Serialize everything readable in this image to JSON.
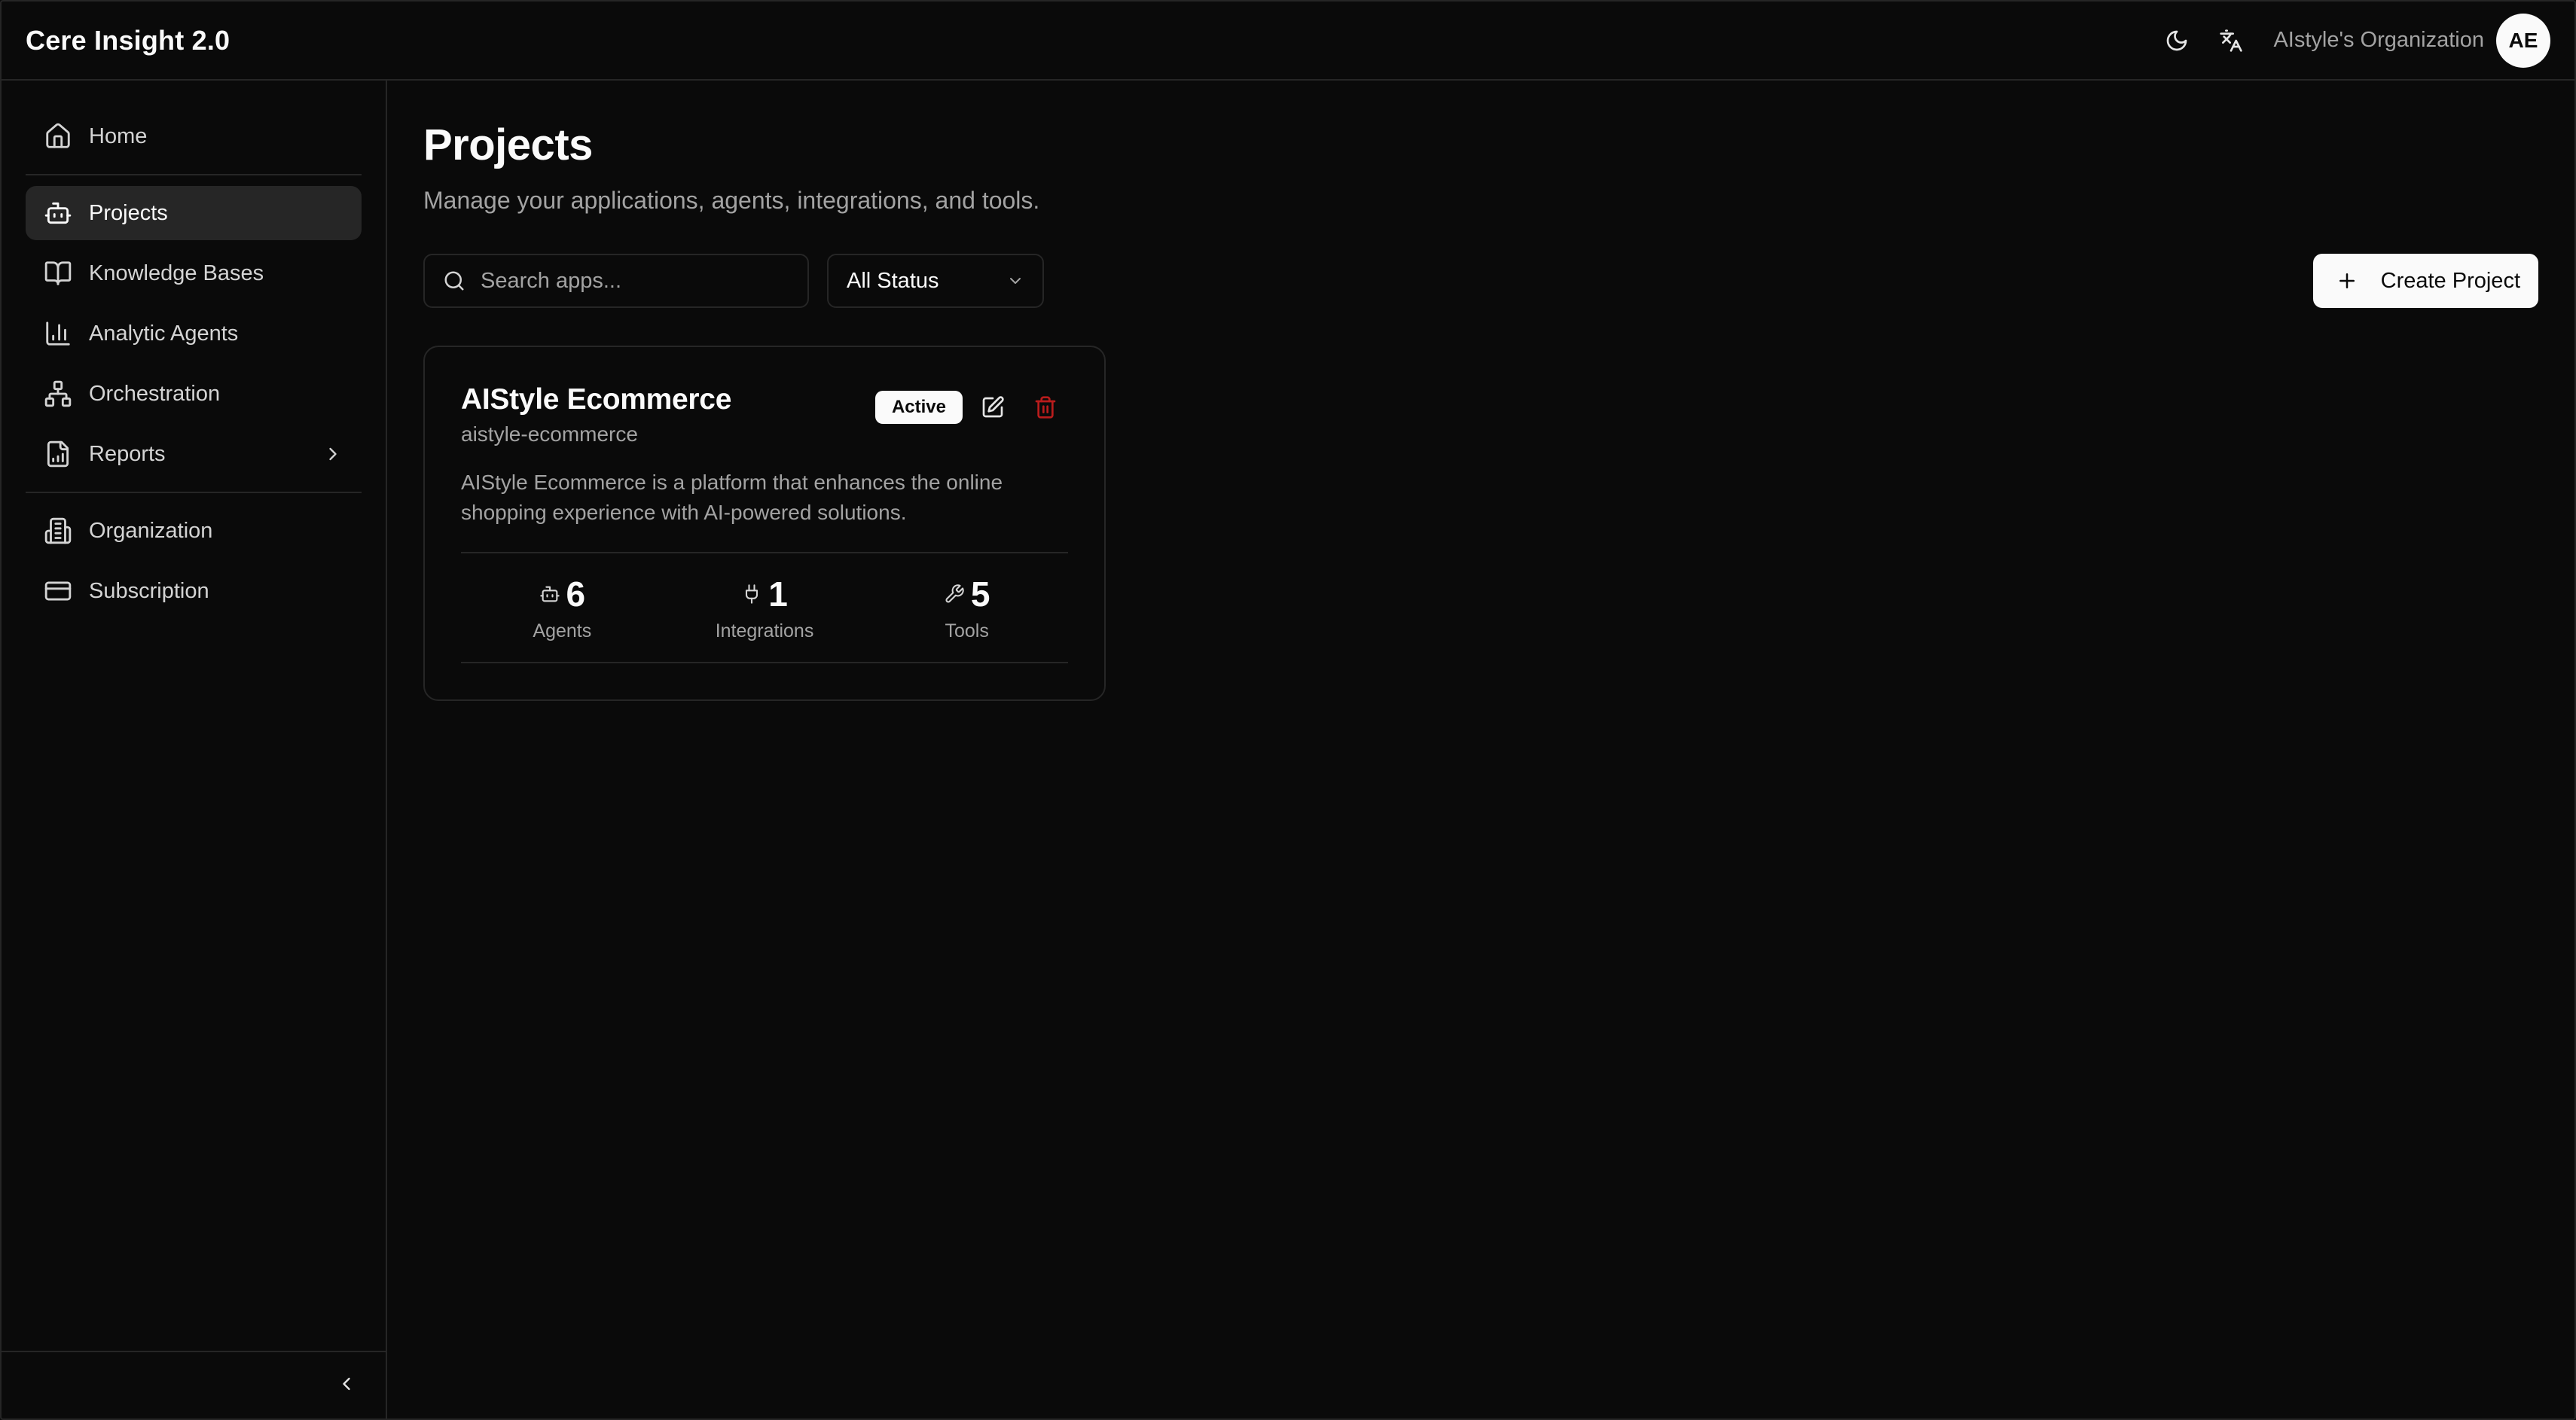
{
  "app": {
    "title": "Cere Insight 2.0"
  },
  "header": {
    "theme_icon": "moon-icon",
    "language_icon": "translate-icon",
    "org_name": "AIstyle's Organization",
    "avatar_initials": "AE"
  },
  "sidebar": {
    "items": [
      {
        "label": "Home",
        "icon": "home-icon"
      },
      {
        "label": "Projects",
        "icon": "bot-icon",
        "active": true
      },
      {
        "label": "Knowledge Bases",
        "icon": "book-icon"
      },
      {
        "label": "Analytic Agents",
        "icon": "bar-chart-icon"
      },
      {
        "label": "Orchestration",
        "icon": "network-icon"
      },
      {
        "label": "Reports",
        "icon": "file-chart-icon",
        "has_submenu": true
      }
    ],
    "secondary_items": [
      {
        "label": "Organization",
        "icon": "building-icon"
      },
      {
        "label": "Subscription",
        "icon": "credit-card-icon"
      }
    ],
    "collapse_icon": "chevron-left-icon"
  },
  "main": {
    "title": "Projects",
    "subtitle": "Manage your applications, agents, integrations, and tools.",
    "search": {
      "placeholder": "Search apps...",
      "value": ""
    },
    "status_filter": {
      "selected": "All Status"
    },
    "create_label": "Create Project"
  },
  "projects": [
    {
      "name": "AIStyle Ecommerce",
      "slug": "aistyle-ecommerce",
      "status": "Active",
      "description": "AIStyle Ecommerce is a platform that enhances the online shopping experience with AI-powered solutions.",
      "stats": [
        {
          "value": "6",
          "label": "Agents",
          "icon": "bot-icon"
        },
        {
          "value": "1",
          "label": "Integrations",
          "icon": "plug-icon"
        },
        {
          "value": "5",
          "label": "Tools",
          "icon": "wrench-icon"
        }
      ]
    }
  ],
  "colors": {
    "background": "#0a0a0a",
    "border": "#262626",
    "danger": "#b91c1c",
    "foreground": "#fafafa"
  }
}
